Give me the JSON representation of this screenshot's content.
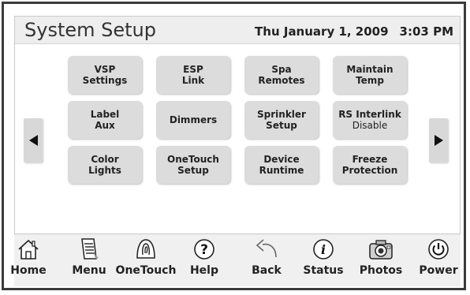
{
  "header": {
    "title": "System Setup",
    "date": "Thu January 1, 2009",
    "time": "3:03 PM"
  },
  "nav": {
    "prev_icon": "triangle-left-icon",
    "next_icon": "triangle-right-icon"
  },
  "tiles": [
    {
      "line1": "VSP",
      "line2": "Settings"
    },
    {
      "line1": "ESP",
      "line2": "Link"
    },
    {
      "line1": "Spa",
      "line2": "Remotes"
    },
    {
      "line1": "Maintain",
      "line2": "Temp"
    },
    {
      "line1": "Label",
      "line2": "Aux"
    },
    {
      "line1": "Dimmers",
      "line2": ""
    },
    {
      "line1": "Sprinkler",
      "line2": "Setup"
    },
    {
      "line1": "RS Interlink",
      "line2": "Disable"
    },
    {
      "line1": "Color",
      "line2": "Lights"
    },
    {
      "line1": "OneTouch",
      "line2": "Setup"
    },
    {
      "line1": "Device",
      "line2": "Runtime"
    },
    {
      "line1": "Freeze",
      "line2": "Protection"
    }
  ],
  "toolbar": [
    {
      "label": "Home",
      "icon": "house-icon"
    },
    {
      "label": "Menu",
      "icon": "notepad-icon"
    },
    {
      "label": "OneTouch",
      "icon": "fingerprint-icon"
    },
    {
      "label": "Help",
      "icon": "question-icon"
    },
    {
      "label": "Back",
      "icon": "back-arrow-icon"
    },
    {
      "label": "Status",
      "icon": "info-icon"
    },
    {
      "label": "Photos",
      "icon": "camera-icon"
    },
    {
      "label": "Power",
      "icon": "power-icon"
    }
  ],
  "colors": {
    "header_bg": "#eeeeee",
    "tile_bg": "#dcdcdc",
    "frame": "#3a3a3a"
  }
}
